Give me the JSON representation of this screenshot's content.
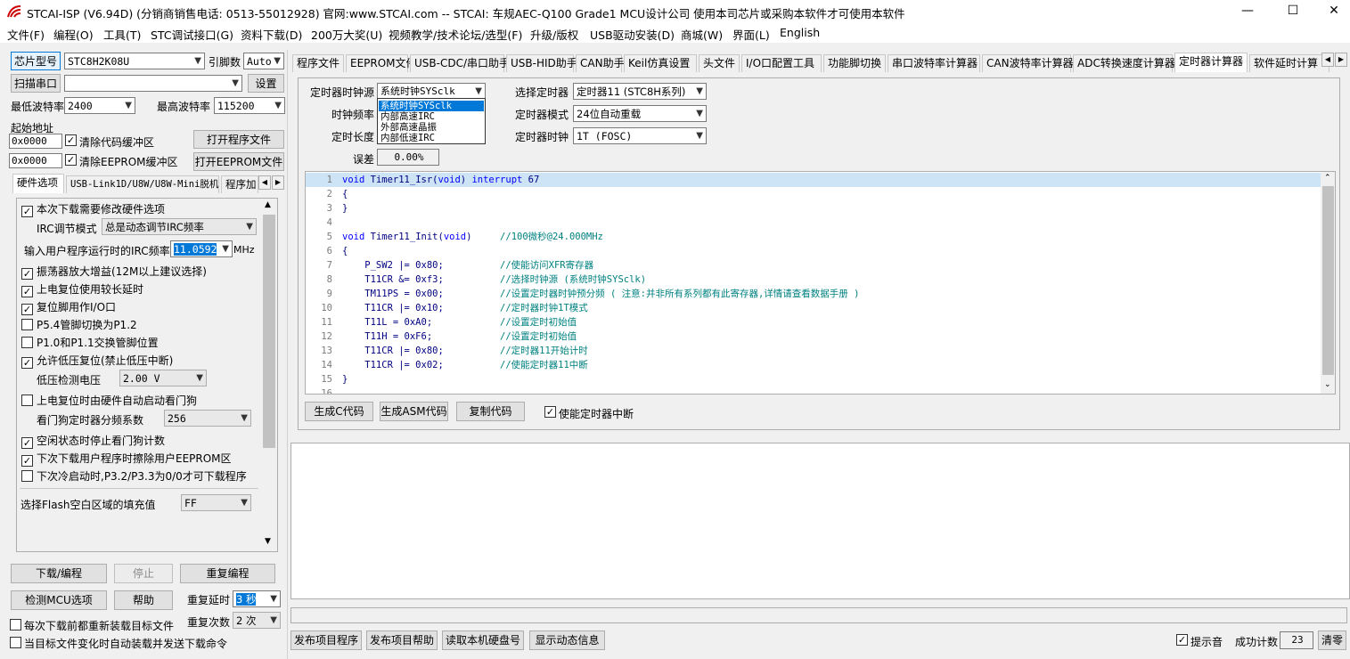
{
  "window": {
    "title": "STCAI-ISP (V6.94D) (分销商销售电话: 0513-55012928) 官网:www.STCAI.com  -- STCAI: 车规AEC-Q100 Grade1 MCU设计公司 使用本司芯片或采购本软件才可使用本软件",
    "minimize": "—",
    "maximize": "☐",
    "close": "✕"
  },
  "menu": [
    "文件(F)",
    "编程(O)",
    "工具(T)",
    "STC调试接口(G)",
    "资料下载(D)",
    "200万大奖(U)",
    "视频教学/技术论坛/选型(F)",
    "升级/版权",
    "USB驱动安装(D)",
    "商城(W)",
    "界面(L)",
    "English"
  ],
  "left": {
    "chip_btn": "芯片型号",
    "chip_value": "STC8H2K08U",
    "pins_label": "引脚数",
    "pins_value": "Auto",
    "scan_btn": "扫描串口",
    "port_value": "",
    "settings_btn": "设置",
    "min_baud_label": "最低波特率",
    "min_baud_value": "2400",
    "max_baud_label": "最高波特率",
    "max_baud_value": "115200",
    "start_addr_label": "起始地址",
    "addr1": "0x0000",
    "clear_code_label": "清除代码缓冲区",
    "open_prog_btn": "打开程序文件",
    "addr2": "0x0000",
    "clear_eeprom_label": "清除EEPROM缓冲区",
    "open_eeprom_btn": "打开EEPROM文件",
    "tabs": [
      "硬件选项",
      "USB-Link1D/U8W/U8W-Mini脱机",
      "程序加"
    ],
    "options": {
      "opt1": "本次下载需要修改硬件选项",
      "irc_mode_label": "IRC调节模式",
      "irc_mode_value": "总是动态调节IRC频率",
      "irc_freq_label": "输入用户程序运行时的IRC频率",
      "irc_freq_value": "11.0592",
      "irc_freq_unit": "MHz",
      "opt2": "振荡器放大增益(12M以上建议选择)",
      "opt3": "上电复位使用较长延时",
      "opt4": "复位脚用作I/O口",
      "opt5": "P5.4管脚切换为P1.2",
      "opt6": "P1.0和P1.1交换管脚位置",
      "opt7": "允许低压复位(禁止低压中断)",
      "lvd_label": "低压检测电压",
      "lvd_value": "2.00 V",
      "opt8": "上电复位时由硬件自动启动看门狗",
      "wdt_label": "看门狗定时器分频系数",
      "wdt_value": "256",
      "opt9": "空闲状态时停止看门狗计数",
      "opt10": "下次下载用户程序时擦除用户EEPROM区",
      "opt11": "下次冷启动时,P3.2/P3.3为0/0才可下载程序",
      "fill_label": "选择Flash空白区域的填充值",
      "fill_value": "FF"
    },
    "download_btn": "下载/编程",
    "stop_btn": "停止",
    "reprog_btn": "重复编程",
    "detect_btn": "检测MCU选项",
    "help_btn": "帮助",
    "repeat_delay_label": "重复延时",
    "repeat_delay_value": "3 秒",
    "repeat_count_label": "重复次数",
    "repeat_count_value": "2 次",
    "reload_label": "每次下载前都重新装载目标文件",
    "auto_label": "当目标文件变化时自动装载并发送下载命令"
  },
  "right_tabs": [
    "程序文件",
    "EEPROM文件",
    "USB-CDC/串口助手",
    "USB-HID助手",
    "CAN助手",
    "Keil仿真设置",
    "头文件",
    "I/O口配置工具",
    "功能脚切换",
    "串口波特率计算器",
    "CAN波特率计算器",
    "ADC转换速度计算器",
    "定时器计算器",
    "软件延时计算"
  ],
  "timer": {
    "clock_src_label": "定时器时钟源",
    "clock_src_value": "系统时钟SYSclk",
    "clock_freq_label": "时钟频率",
    "timer_len_label": "定时长度",
    "error_label": "误差",
    "error_value": "0.00%",
    "select_timer_label": "选择定时器",
    "select_timer_value": "定时器11 (STC8H系列)",
    "timer_mode_label": "定时器模式",
    "timer_mode_value": "24位自动重载",
    "timer_clock_label": "定时器时钟",
    "timer_clock_value": "1T  (FOSC)",
    "dropdown_items": [
      "系统时钟SYSclk",
      "内部高速IRC",
      "外部高速晶振",
      "内部低速IRC"
    ],
    "gen_c_btn": "生成C代码",
    "gen_asm_btn": "生成ASM代码",
    "copy_btn": "复制代码",
    "enable_int_label": "使能定时器中断"
  },
  "code_lines": [
    {
      "n": "1",
      "t": "void Timer11_Isr(void) interrupt 67",
      "c": ""
    },
    {
      "n": "2",
      "t": "{",
      "c": ""
    },
    {
      "n": "3",
      "t": "}",
      "c": ""
    },
    {
      "n": "4",
      "t": "",
      "c": ""
    },
    {
      "n": "5",
      "t": "void Timer11_Init(void)     ",
      "c": "//100微秒@24.000MHz"
    },
    {
      "n": "6",
      "t": "{",
      "c": ""
    },
    {
      "n": "7",
      "t": "    P_SW2 |= 0x80;          ",
      "c": "//使能访问XFR寄存器"
    },
    {
      "n": "8",
      "t": "    T11CR &= 0xf3;          ",
      "c": "//选择时钟源 (系统时钟SYSclk)"
    },
    {
      "n": "9",
      "t": "    TM11PS = 0x00;          ",
      "c": "//设置定时器时钟预分频 ( 注意:并非所有系列都有此寄存器,详情请查看数据手册 )"
    },
    {
      "n": "10",
      "t": "    T11CR |= 0x10;          ",
      "c": "//定时器时钟1T模式"
    },
    {
      "n": "11",
      "t": "    T11L = 0xA0;            ",
      "c": "//设置定时初始值"
    },
    {
      "n": "12",
      "t": "    T11H = 0xF6;            ",
      "c": "//设置定时初始值"
    },
    {
      "n": "13",
      "t": "    T11CR |= 0x80;          ",
      "c": "//定时器11开始计时"
    },
    {
      "n": "14",
      "t": "    T11CR |= 0x02;          ",
      "c": "//使能定时器11中断"
    },
    {
      "n": "15",
      "t": "}",
      "c": ""
    },
    {
      "n": "16",
      "t": "",
      "c": ""
    }
  ],
  "bottom": {
    "publish_btn": "发布项目程序",
    "publish_help_btn": "发布项目帮助",
    "read_disk_btn": "读取本机硬盘号",
    "show_dyn_btn": "显示动态信息",
    "beep_label": "提示音",
    "success_label": "成功计数",
    "success_value": "23",
    "clear_btn": "清零"
  },
  "colors": {
    "accent": "#0078d7",
    "highlight_line": "#cde3f6",
    "comment": "#008080",
    "keyword": "#0000ff"
  }
}
